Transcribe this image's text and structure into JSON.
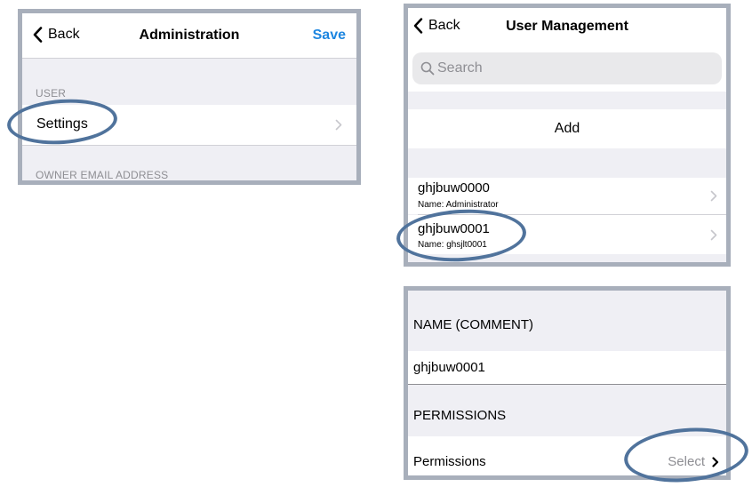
{
  "admin_screen": {
    "back_label": "Back",
    "title": "Administration",
    "save_label": "Save",
    "user_section_header": "USER",
    "settings_label": "Settings",
    "owner_email_header": "OWNER EMAIL ADDRESS"
  },
  "user_mgmt_screen": {
    "back_label": "Back",
    "title": "User Management",
    "search_placeholder": "Search",
    "add_label": "Add",
    "users": [
      {
        "id": "ghjbuw0000",
        "name": "Name: Administrator"
      },
      {
        "id": "ghjbuw0001",
        "name": "Name: ghsjlt0001"
      }
    ]
  },
  "user_detail_screen": {
    "name_section_header": "NAME (COMMENT)",
    "name_value": "ghjbuw0001",
    "permissions_section_header": "PERMISSIONS",
    "permissions_label": "Permissions",
    "permissions_value": "Select"
  },
  "colors": {
    "accent": "#1d86e0",
    "highlight_ring": "#50739c",
    "panel_border": "#a8afbb",
    "group_background": "#efeff4"
  },
  "icons": [
    "chevron-left-icon",
    "chevron-right-icon",
    "search-icon"
  ]
}
